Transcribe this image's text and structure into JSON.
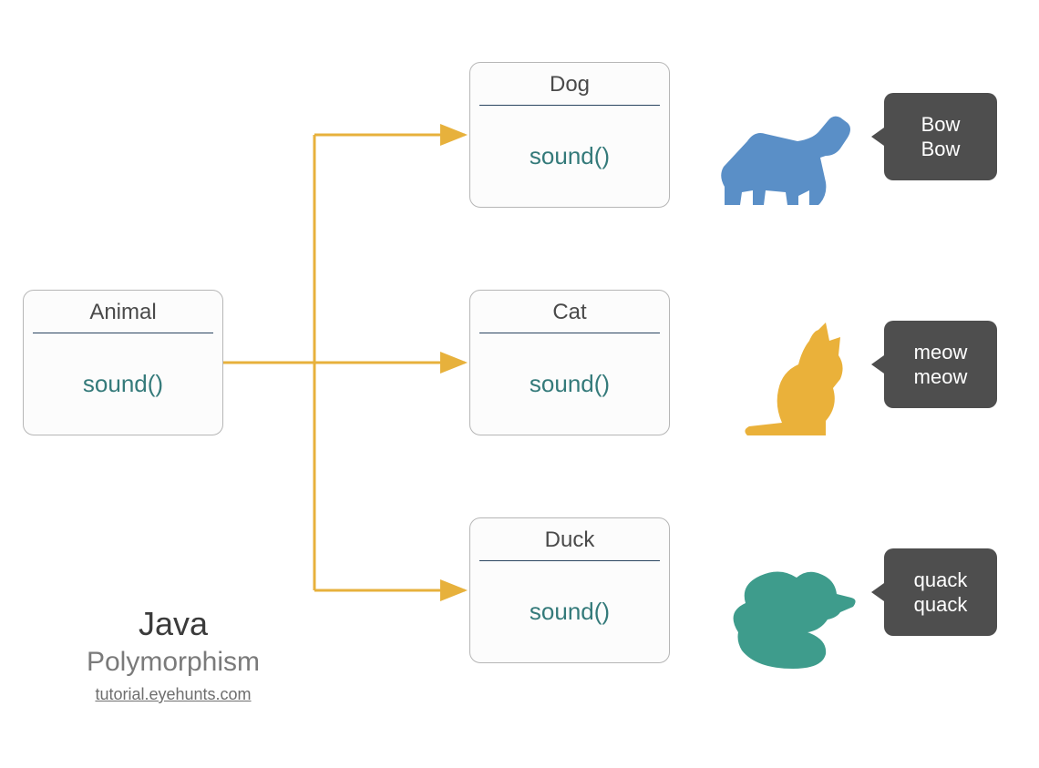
{
  "diagram": {
    "parent": {
      "name": "Animal",
      "method": "sound()"
    },
    "children": [
      {
        "name": "Dog",
        "method": "sound()",
        "says": "Bow\nBow",
        "icon": "dog-icon",
        "color": "#5a8fc7"
      },
      {
        "name": "Cat",
        "method": "sound()",
        "says": "meow\nmeow",
        "icon": "cat-icon",
        "color": "#eab13a"
      },
      {
        "name": "Duck",
        "method": "sound()",
        "says": "quack\nquack",
        "icon": "duck-icon",
        "color": "#3e9c8c"
      }
    ],
    "arrow_color": "#e7b13c"
  },
  "caption": {
    "line1": "Java",
    "line2": "Polymorphism",
    "line3": "tutorial.eyehunts.com"
  },
  "colors": {
    "box_border": "#b6b6b6",
    "box_title_underline": "#2a4560",
    "method_text": "#347a7a",
    "bubble_bg": "#4e4e4e",
    "bubble_text": "#ffffff"
  }
}
